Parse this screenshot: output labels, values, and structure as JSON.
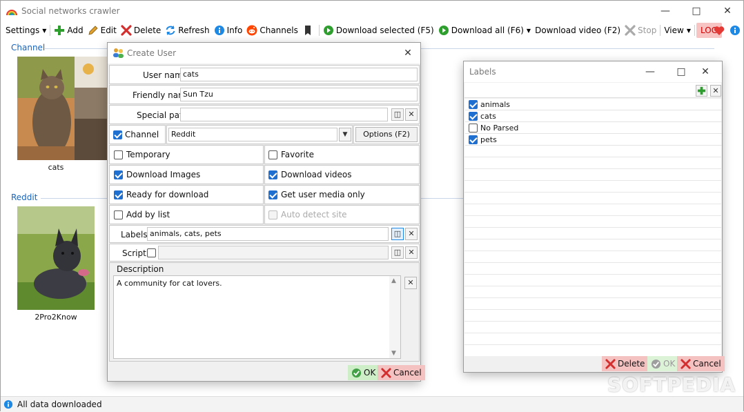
{
  "window": {
    "title": "Social networks crawler"
  },
  "toolbar": {
    "settings": "Settings",
    "add": "Add",
    "edit": "Edit",
    "delete": "Delete",
    "refresh": "Refresh",
    "info": "Info",
    "channels": "Channels",
    "download_selected": "Download selected (F5)",
    "download_all": "Download all (F6)",
    "download_video": "Download video (F2)",
    "stop": "Stop",
    "view": "View",
    "log": "LOG"
  },
  "groups": [
    {
      "label": "Channel",
      "items": [
        {
          "caption": "cats"
        }
      ]
    },
    {
      "label": "Reddit",
      "items": [
        {
          "caption": "2Pro2Know"
        }
      ]
    }
  ],
  "status": {
    "text": "All data downloaded"
  },
  "create_user": {
    "title": "Create User",
    "user_name_label": "User name",
    "user_name_value": "cats",
    "friendly_name_label": "Friendly name",
    "friendly_name_value": "Sun Tzu",
    "special_path_label": "Special path",
    "special_path_value": "",
    "channel_label": "Channel",
    "channel_checked": true,
    "site_value": "Reddit",
    "options_button": "Options (F2)",
    "temporary": "Temporary",
    "favorite": "Favorite",
    "download_images": "Download Images",
    "download_videos": "Download videos",
    "ready_for_download": "Ready for download",
    "get_user_media_only": "Get user media only",
    "add_by_list": "Add by list",
    "auto_detect_site": "Auto detect site",
    "labels_label": "Labels",
    "labels_value": "animals, cats, pets",
    "script_label": "Script",
    "description_label": "Description",
    "description_value": "A community for cat lovers.",
    "ok": "OK",
    "cancel": "Cancel"
  },
  "labels_dialog": {
    "title": "Labels",
    "items": [
      {
        "label": "animals",
        "checked": true
      },
      {
        "label": "cats",
        "checked": true
      },
      {
        "label": "No Parsed",
        "checked": false
      },
      {
        "label": "pets",
        "checked": true
      }
    ],
    "delete": "Delete",
    "ok": "OK",
    "cancel": "Cancel"
  },
  "watermark": "SOFTPEDIA",
  "colors": {
    "accent": "#1f6fd0",
    "group_label": "#1565c0",
    "log_bg": "#f7c3c3",
    "ok_bg": "#cdeec6",
    "cancel_bg": "#f5c2c2"
  }
}
